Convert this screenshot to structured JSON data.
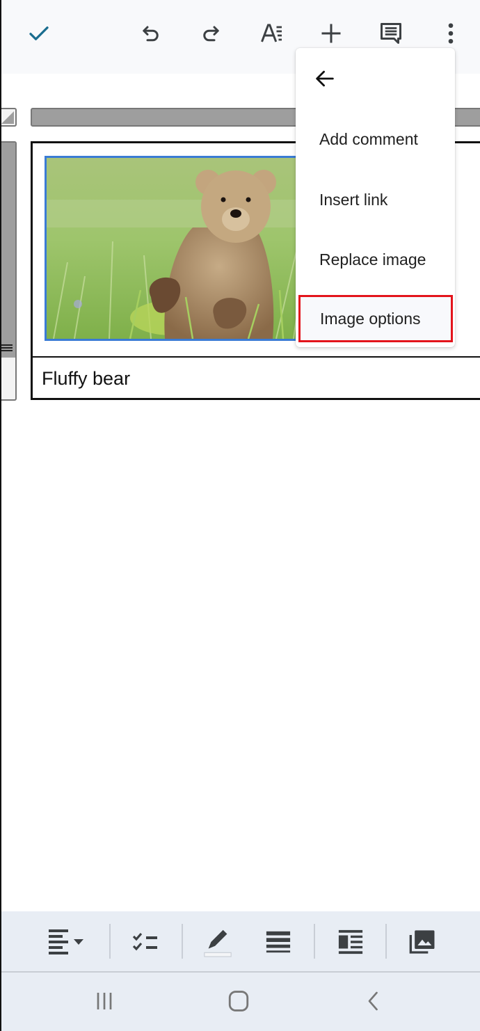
{
  "toolbar": {
    "icons": [
      "check-icon",
      "undo-icon",
      "redo-icon",
      "text-format-icon",
      "insert-icon",
      "comment-icon",
      "more-vert-icon"
    ],
    "accent_color": "#1a6d8f"
  },
  "document": {
    "table": {
      "image_alt": "Bear cub standing in a grassy meadow",
      "caption": "Fluffy bear"
    }
  },
  "menu": {
    "back_icon": "arrow-back-icon",
    "items": [
      {
        "label": "Add comment"
      },
      {
        "label": "Insert link"
      },
      {
        "label": "Replace image"
      },
      {
        "label": "Image options",
        "highlighted": true
      }
    ],
    "highlight_color": "#e3141b"
  },
  "format_bar": {
    "icons": [
      "align-left-dropdown-icon",
      "checklist-icon",
      "highlight-pen-icon",
      "line-spacing-icon",
      "text-wrap-icon",
      "image-gallery-icon"
    ]
  },
  "system_nav": {
    "icons": [
      "recent-apps-icon",
      "home-icon",
      "back-icon"
    ]
  }
}
